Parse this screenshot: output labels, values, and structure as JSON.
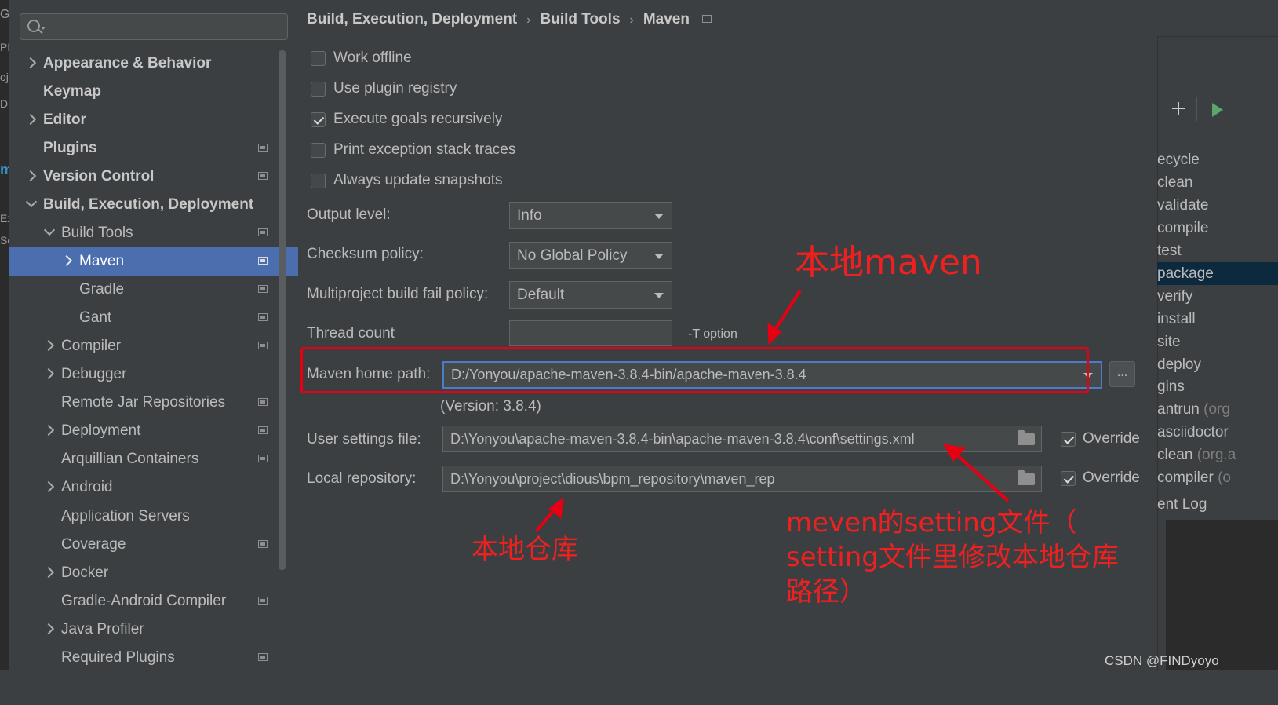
{
  "background_fragments": [
    "G",
    "PM",
    "oj",
    "D",
    "m",
    "Ex",
    "Sc"
  ],
  "search": {
    "placeholder": "",
    "value": ""
  },
  "sidebar": {
    "items": [
      {
        "label": "Appearance & Behavior",
        "icon": "chevron-right-icon"
      },
      {
        "label": "Keymap"
      },
      {
        "label": "Editor",
        "icon": "chevron-right-icon"
      },
      {
        "label": "Plugins",
        "badge_icon": "project-settings-icon"
      },
      {
        "label": "Version Control",
        "icon": "chevron-right-icon",
        "badge_icon": "project-settings-icon"
      },
      {
        "label": "Build, Execution, Deployment",
        "icon": "chevron-down-icon"
      },
      {
        "label": "Build Tools",
        "icon": "chevron-down-icon",
        "badge_icon": "project-settings-icon"
      },
      {
        "label": "Maven",
        "icon": "chevron-right-icon",
        "badge_icon": "project-settings-icon",
        "selected": true
      },
      {
        "label": "Gradle",
        "badge_icon": "project-settings-icon"
      },
      {
        "label": "Gant",
        "badge_icon": "project-settings-icon"
      },
      {
        "label": "Compiler",
        "icon": "chevron-right-icon",
        "badge_icon": "project-settings-icon"
      },
      {
        "label": "Debugger",
        "icon": "chevron-right-icon"
      },
      {
        "label": "Remote Jar Repositories",
        "badge_icon": "project-settings-icon"
      },
      {
        "label": "Deployment",
        "icon": "chevron-right-icon",
        "badge_icon": "project-settings-icon"
      },
      {
        "label": "Arquillian Containers",
        "badge_icon": "project-settings-icon"
      },
      {
        "label": "Android",
        "icon": "chevron-right-icon"
      },
      {
        "label": "Application Servers"
      },
      {
        "label": "Coverage",
        "badge_icon": "project-settings-icon"
      },
      {
        "label": "Docker",
        "icon": "chevron-right-icon"
      },
      {
        "label": "Gradle-Android Compiler",
        "badge_icon": "project-settings-icon"
      },
      {
        "label": "Java Profiler",
        "icon": "chevron-right-icon"
      },
      {
        "label": "Required Plugins",
        "badge_icon": "project-settings-icon"
      }
    ]
  },
  "breadcrumb": {
    "items": [
      "Build, Execution, Deployment",
      "Build Tools",
      "Maven"
    ],
    "separator": "›"
  },
  "options": {
    "work_offline": {
      "label": "Work offline",
      "checked": false
    },
    "use_plugin_registry": {
      "label": "Use plugin registry",
      "checked": false
    },
    "execute_goals_recursively": {
      "label": "Execute goals recursively",
      "checked": true
    },
    "print_exception_stack_traces": {
      "label": "Print exception stack traces",
      "checked": false
    },
    "always_update_snapshots": {
      "label": "Always update snapshots",
      "checked": false
    }
  },
  "form": {
    "output_level": {
      "label": "Output level:",
      "value": "Info"
    },
    "checksum_policy": {
      "label": "Checksum policy:",
      "value": "No Global Policy"
    },
    "multiproject_fail_policy": {
      "label": "Multiproject build fail policy:",
      "value": "Default"
    },
    "thread_count": {
      "label": "Thread count",
      "value": "",
      "hint": "-T option"
    },
    "maven_home": {
      "label": "Maven home path:",
      "value": "D:/Yonyou/apache-maven-3.8.4-bin/apache-maven-3.8.4",
      "browse_label": "...",
      "version": "(Version: 3.8.4)"
    },
    "user_settings": {
      "label": "User settings file:",
      "value": "D:\\Yonyou\\apache-maven-3.8.4-bin\\apache-maven-3.8.4\\conf\\settings.xml",
      "override_label": "Override",
      "override_checked": true
    },
    "local_repo": {
      "label": "Local repository:",
      "value": "D:\\Yonyou\\project\\dious\\bpm_repository\\maven_rep",
      "override_label": "Override",
      "override_checked": true
    }
  },
  "right_panel": {
    "lifecycle": [
      "ecycle",
      "clean",
      "validate",
      "compile",
      "test",
      "package",
      "verify",
      "install",
      "site",
      "deploy"
    ],
    "selected": "package",
    "plugins_header": "gins",
    "plugins": [
      {
        "name": "antrun",
        "suffix": " (org"
      },
      {
        "name": "asciidoctor",
        "suffix": ""
      },
      {
        "name": "clean",
        "suffix": " (org.a"
      },
      {
        "name": "compiler",
        "suffix": " (o"
      }
    ],
    "event_log": "ent Log"
  },
  "annotations": {
    "local_maven": "本地maven",
    "local_repo": "本地仓库",
    "setting_file_lines": [
      "meven的setting文件（",
      "setting文件里修改本地仓库",
      "路径）"
    ],
    "color": "#e60012"
  },
  "watermark": "CSDN @FINDyoyo"
}
